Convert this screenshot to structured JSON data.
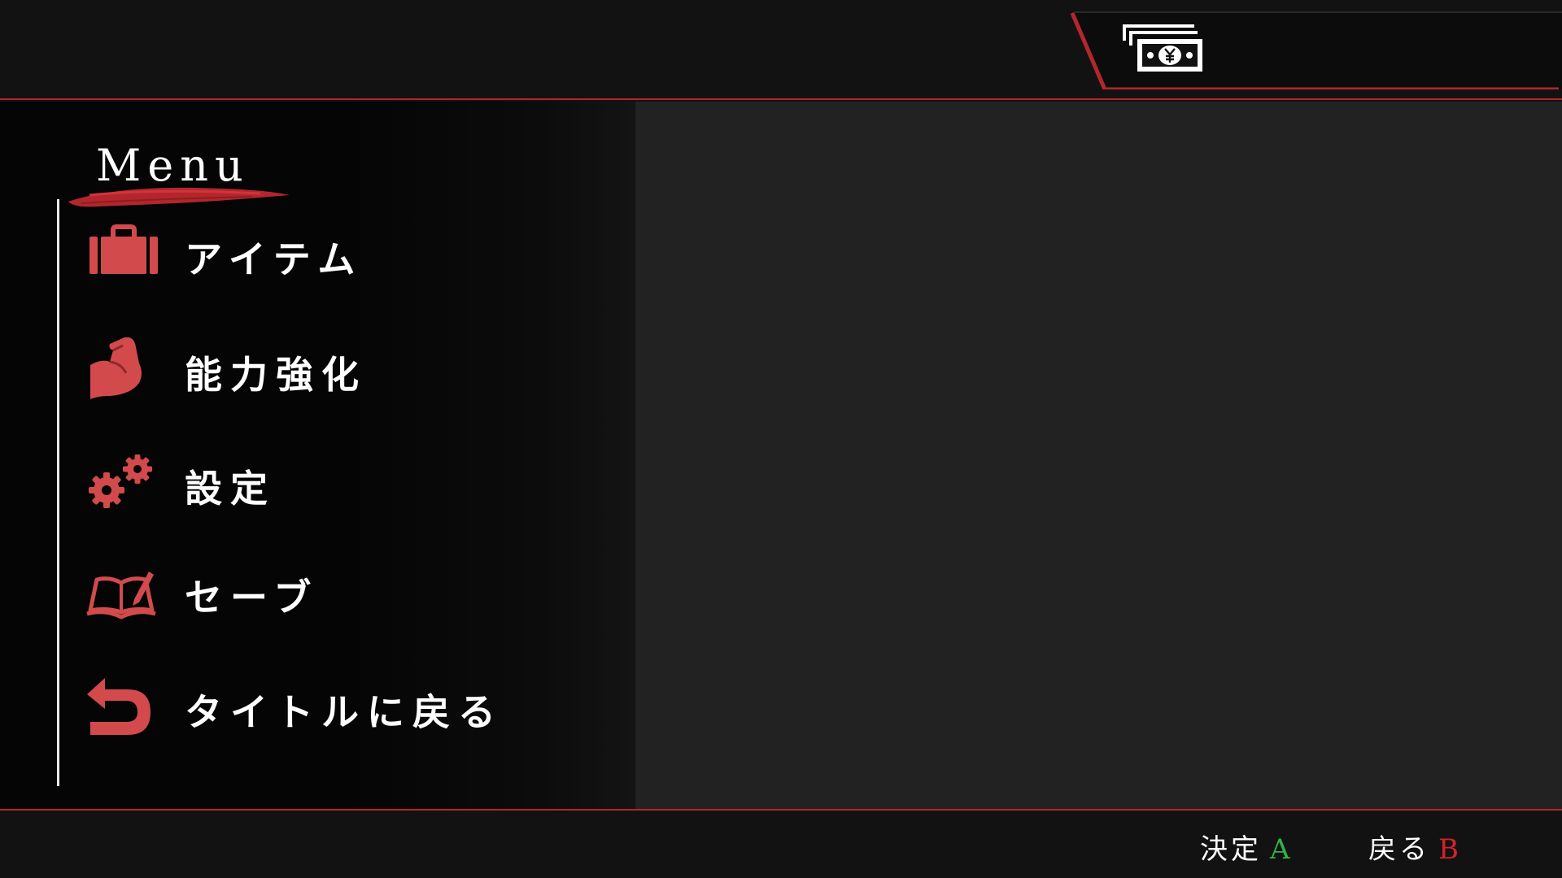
{
  "money": {
    "icon": "yen-banknote-icon",
    "value": ""
  },
  "menu": {
    "title": "Menu",
    "items": [
      {
        "label": "アイテム",
        "icon": "briefcase-icon"
      },
      {
        "label": "能力強化",
        "icon": "flexed-arm-icon"
      },
      {
        "label": "設定",
        "icon": "gears-icon"
      },
      {
        "label": "セーブ",
        "icon": "book-pen-icon"
      },
      {
        "label": "タイトルに戻る",
        "icon": "return-arrow-icon"
      }
    ]
  },
  "content": {},
  "hints": {
    "confirm": {
      "label": "決定",
      "key": "A",
      "key_color": "#2fb344"
    },
    "back": {
      "label": "戻る",
      "key": "B",
      "key_color": "#d3222a"
    }
  },
  "colors": {
    "accent_red": "#b3262c",
    "icon_red": "#d24a4c",
    "panel_dark": "#050505",
    "panel_right": "#222222",
    "bar": "#121213"
  }
}
